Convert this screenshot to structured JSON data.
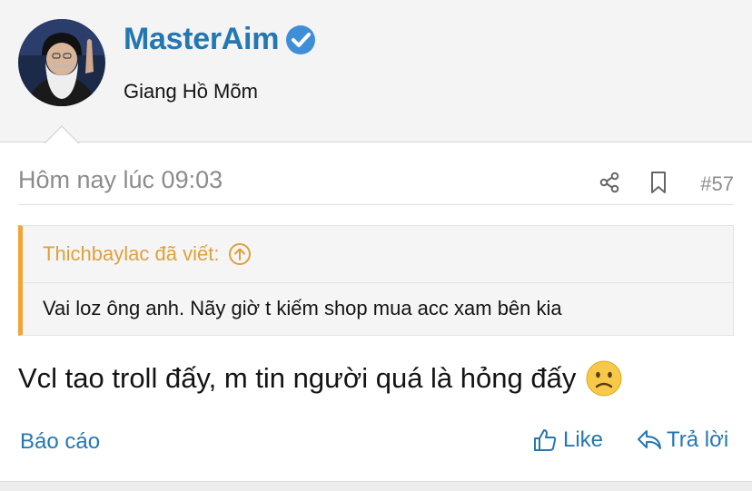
{
  "author": {
    "username": "MasterAim",
    "title": "Giang Hồ Mõm",
    "verified": true,
    "avatar_icon": "avatar-portrait"
  },
  "post": {
    "timestamp": "Hôm nay lúc 09:03",
    "number": "#57",
    "message": "Vcl tao troll đấy, m tin người quá là hỏng đấy",
    "emoji": "slightly-frowning-face-emoji"
  },
  "quote": {
    "header": "Thichbaylac đã viết:",
    "body": "Vai loz ông anh. Nãy giờ t kiếm shop mua acc xam bên kia"
  },
  "actions": {
    "report": "Báo cáo",
    "like": "Like",
    "reply": "Trả lời"
  },
  "colors": {
    "link": "#2577b1",
    "quote_accent": "#f0a534",
    "muted": "#8c8c8c"
  }
}
